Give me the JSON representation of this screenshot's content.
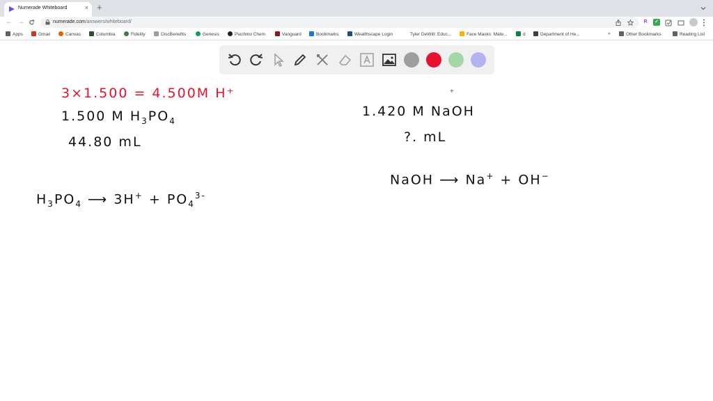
{
  "browser": {
    "tab_title": "Numerade Whiteboard",
    "tab_close": "×",
    "new_tab": "+",
    "url_host": "numerade.com",
    "url_path": "/answers/whiteboard/",
    "back": "←",
    "forward": "→",
    "reload": "C",
    "extensions": [
      {
        "letter": "R",
        "color": "#a142f4"
      },
      {
        "letter": "✓",
        "color": "#34a853"
      }
    ]
  },
  "bookmarks": [
    {
      "label": "Apps",
      "icon_color": "#5f6368"
    },
    {
      "label": "Gmail",
      "icon_color": "#d93025"
    },
    {
      "label": "Canvas",
      "icon_color": "#e66000"
    },
    {
      "label": "Columbia",
      "icon_color": "#2f4f2f"
    },
    {
      "label": "Fidelity",
      "icon_color": "#3d7d3d"
    },
    {
      "label": "DiscBenefits",
      "icon_color": "#9e9e9e"
    },
    {
      "label": "Genesis",
      "icon_color": "#0f9d58"
    },
    {
      "label": "Piuchino Chem",
      "icon_color": "#202124"
    },
    {
      "label": "Vanguard",
      "icon_color": "#96151d"
    },
    {
      "label": "Bookmarks",
      "icon_color": "#1a73e8"
    },
    {
      "label": "Wealthscape Login",
      "icon_color": "#1d4e89"
    },
    {
      "label": "Tyler DeWitt: Educ...",
      "icon_color": "#ffffff"
    },
    {
      "label": "Face Masks: Mate...",
      "icon_color": "#f4b400"
    },
    {
      "label": "d",
      "icon_color": "#0b8043"
    },
    {
      "label": "Department of He...",
      "icon_color": "#3c4043"
    },
    {
      "label": "»",
      "icon_color": "#ffffff"
    },
    {
      "label": "Other Bookmarks",
      "icon_color": "#5f6368"
    },
    {
      "label": "Reading List",
      "icon_color": "#5f6368"
    }
  ],
  "whiteboard_tools": [
    {
      "name": "undo-icon"
    },
    {
      "name": "redo-icon"
    },
    {
      "name": "select-pointer-icon"
    },
    {
      "name": "pencil-icon"
    },
    {
      "name": "tools-icon"
    },
    {
      "name": "eraser-icon"
    },
    {
      "name": "text-icon"
    },
    {
      "name": "image-icon"
    }
  ],
  "colors": {
    "gray": "#9e9e9e",
    "red": "#e8112d",
    "green": "#a5d6a7",
    "purple": "#b3b3f0"
  },
  "handwriting": {
    "red_line": "3×1.500 = 4.500M H⁺",
    "line1_prefix": "1.500 M  H",
    "line1_sub1": "3",
    "line1_mid": "PO",
    "line1_sub2": "4",
    "line2": "44.80 mL",
    "eq_left_prefix": "H",
    "eq_left_sub1": "3",
    "eq_left_mid": "PO",
    "eq_left_sub2": "4",
    "eq_arrow": "⟶",
    "eq_right_a": "3H",
    "eq_right_a_sup": "+",
    "eq_plus": "+",
    "eq_right_b": "PO",
    "eq_right_b_sub": "4",
    "eq_right_b_sup": "3-",
    "right_line1": "1.420 M NaOH",
    "right_line2": "?.  mL",
    "naoh_left": "NaOH",
    "naoh_arrow": "⟶",
    "naoh_right_a": "Na",
    "naoh_right_a_sup": "+",
    "naoh_plus": "+",
    "naoh_right_b": "OH",
    "naoh_right_b_sup": "−",
    "cursor": "+"
  }
}
